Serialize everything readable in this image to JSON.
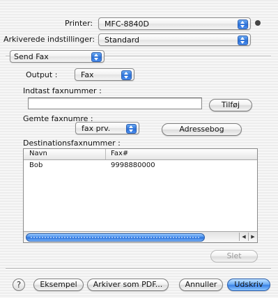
{
  "printer": {
    "label": "Printer:",
    "value": "MFC-8840D"
  },
  "presets": {
    "label": "Arkiverede indstillinger:",
    "value": "Standard"
  },
  "panel": {
    "value": "Send Fax"
  },
  "output": {
    "label": "Output :",
    "value": "Fax"
  },
  "fax_entry": {
    "label": "Indtast faxnummer :",
    "value": "",
    "add_button": "Tilføj"
  },
  "stored": {
    "label": "Gemte faxnumre :",
    "value": "fax prv.",
    "address_button": "Adressebog"
  },
  "destinations": {
    "label": "Destinationsfaxnummer :",
    "columns": [
      "Navn",
      "Fax#"
    ],
    "rows": [
      {
        "name": "Bob",
        "fax": "9998880000"
      }
    ],
    "delete_button": "Slet"
  },
  "footer": {
    "help": "?",
    "preview_button": "Eksempel",
    "save_pdf_button": "Arkiver som PDF...",
    "cancel_button": "Annuller",
    "print_button": "Udskriv"
  },
  "icons": {
    "status": "printer-status-dot-icon",
    "help": "help-icon"
  }
}
